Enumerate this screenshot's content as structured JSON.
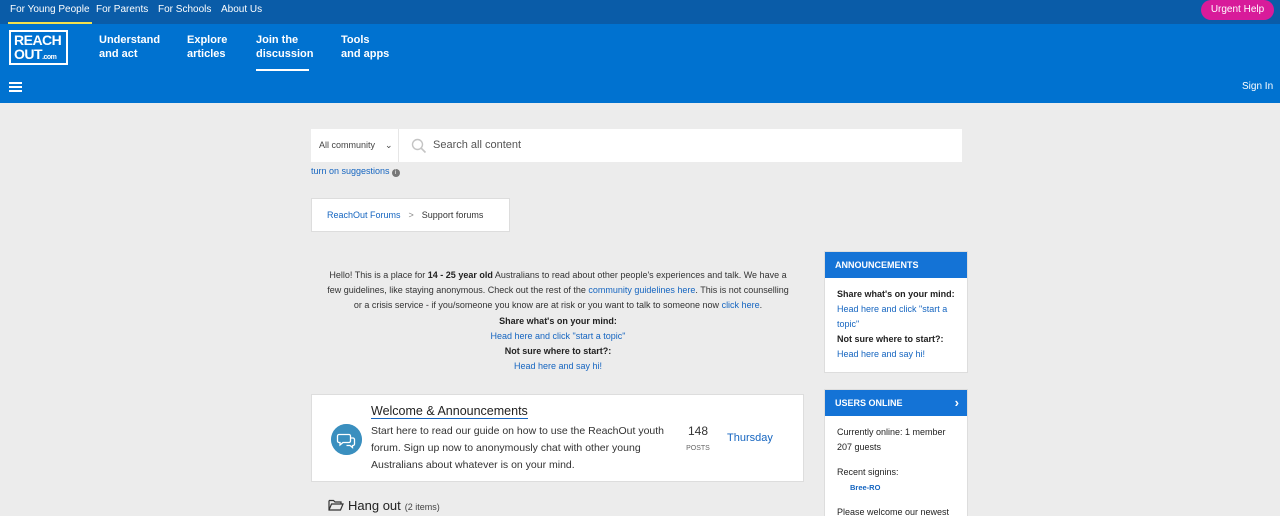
{
  "topbar": {
    "links": [
      "For Young People",
      "For Parents",
      "For Schools",
      "About Us"
    ],
    "urgent_label": "Urgent Help"
  },
  "nav": {
    "logo_line1": "REACH",
    "logo_line2": "OUT",
    "logo_suffix": ".com",
    "items": [
      {
        "line1": "Understand",
        "line2": "and act"
      },
      {
        "line1": "Explore",
        "line2": "articles"
      },
      {
        "line1": "Join the",
        "line2": "discussion"
      },
      {
        "line1": "Tools",
        "line2": "and apps"
      }
    ],
    "signin_label": "Sign In"
  },
  "search": {
    "scope": "All community",
    "placeholder": "Search all content",
    "suggestions_label": "turn on suggestions"
  },
  "breadcrumb": {
    "root": "ReachOut Forums",
    "sep": ">",
    "current": "Support forums"
  },
  "intro": {
    "t1": "Hello! This is a place for ",
    "t1_bold": "14 - 25 year old",
    "t2": " Australians to read about other people's experiences and talk. We have a few guidelines, like staying anonymous. Check out the rest of the ",
    "link1": "community guidelines here",
    "t3": ". This is not counselling or a crisis service - if you/someone you know are at risk or you want to talk to someone now ",
    "link2": "click here",
    "t4": ".",
    "share_title": "Share what's on your mind:",
    "share_link": "Head here and click \"start a topic\"",
    "unsure_title": "Not sure where to start?:",
    "unsure_link": "Head here and say hi!"
  },
  "board": {
    "title": "Welcome & Announcements",
    "description": "Start here to read our guide on how to use the ReachOut youth forum. Sign up now to anonymously chat with other young Australians about whatever is on your mind.",
    "posts": "148",
    "posts_label": "POSTS",
    "last_post": "Thursday"
  },
  "category": {
    "title": "Hang out",
    "count": "(2 items)"
  },
  "announcements": {
    "title": "ANNOUNCEMENTS",
    "share_title": "Share what's on your mind:",
    "share_link": "Head here and click \"start a topic\"",
    "unsure_title": "Not sure where to start?:",
    "unsure_link": "Head here and say hi!"
  },
  "users_online": {
    "title": "USERS ONLINE",
    "currently": "Currently online: 1 member 207 guests",
    "recent_label": "Recent signins:",
    "recent_user": "Bree-RO",
    "welcome": "Please welcome our newest"
  },
  "colors": {
    "topbar": "#0a5ca8",
    "nav": "#0072d0",
    "urgent": "#d81b9a",
    "panel_header": "#1473d6",
    "link": "#1565c0"
  }
}
